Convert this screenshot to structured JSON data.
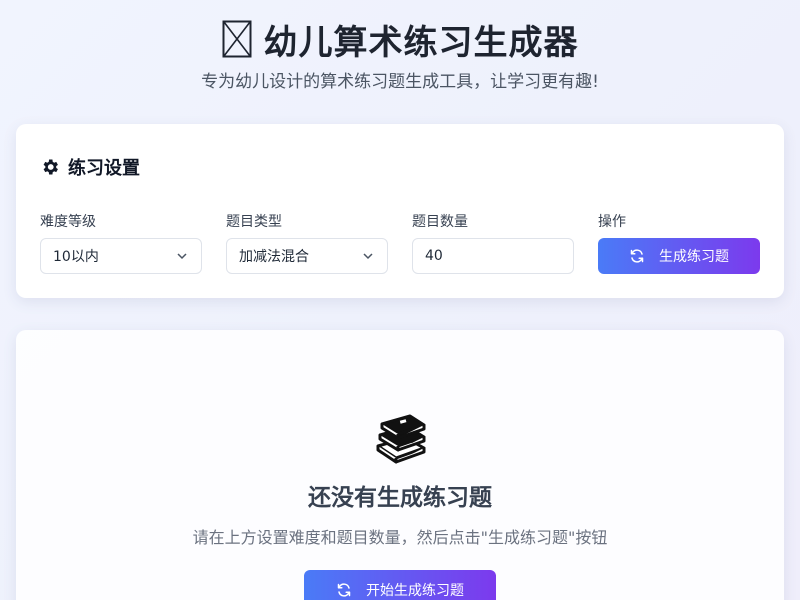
{
  "header": {
    "title": "幼儿算术练习生成器",
    "subtitle": "专为幼儿设计的算术练习题生成工具，让学习更有趣!"
  },
  "settings": {
    "title": "练习设置",
    "difficulty": {
      "label": "难度等级",
      "value": "10以内"
    },
    "type": {
      "label": "题目类型",
      "value": "加减法混合"
    },
    "count": {
      "label": "题目数量",
      "value": "40"
    },
    "actions": {
      "label": "操作",
      "button": "生成练习题"
    }
  },
  "empty": {
    "title": "还没有生成练习题",
    "description": "请在上方设置难度和题目数量，然后点击\"生成练习题\"按钮",
    "button": "开始生成练习题"
  },
  "colors": {
    "accent_start": "#4a7bf7",
    "accent_end": "#7c3aed"
  }
}
